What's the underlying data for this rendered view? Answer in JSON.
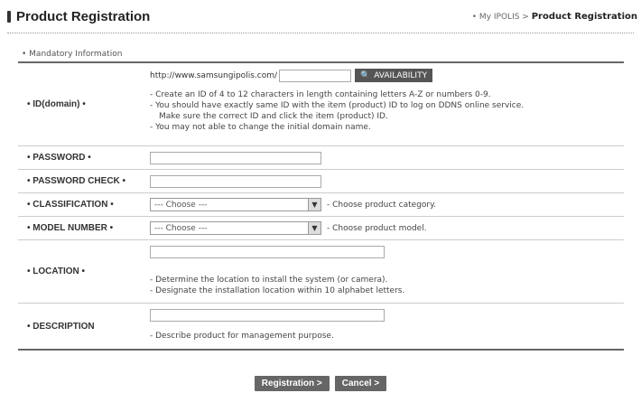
{
  "header": {
    "title": "Product Registration",
    "breadcrumb_prefix": "• My IPOLIS >",
    "breadcrumb_current": "Product Registration"
  },
  "section_label": "• Mandatory Information",
  "fields": {
    "id": {
      "label": "• ID(domain) •",
      "url_prefix": "http://www.samsungipolis.com/",
      "value": "",
      "availability_button": "AVAILABILITY",
      "notes": [
        "- Create an ID of 4 to 12 characters in length containing letters A-Z or numbers 0-9.",
        "- You should have exactly same ID with the item (product) ID to log on DDNS online service.",
        "Make sure the correct ID and click the item (product) ID.",
        "- You may not able to change the initial domain name."
      ]
    },
    "password": {
      "label": "• PASSWORD •",
      "value": ""
    },
    "password_check": {
      "label": "• PASSWORD CHECK •",
      "value": ""
    },
    "classification": {
      "label": "• CLASSIFICATION •",
      "selected": "--- Choose ---",
      "hint": "- Choose product category."
    },
    "model_number": {
      "label": "• MODEL NUMBER •",
      "selected": "--- Choose ---",
      "hint": "- Choose product model."
    },
    "location": {
      "label": "• LOCATION •",
      "value": "",
      "notes": [
        "- Determine the location to install the system (or camera).",
        "- Designate the installation location within 10 alphabet letters."
      ]
    },
    "description": {
      "label": "• DESCRIPTION",
      "value": "",
      "notes": [
        "- Describe product for management purpose."
      ]
    }
  },
  "buttons": {
    "registration": "Registration >",
    "cancel": "Cancel >"
  }
}
